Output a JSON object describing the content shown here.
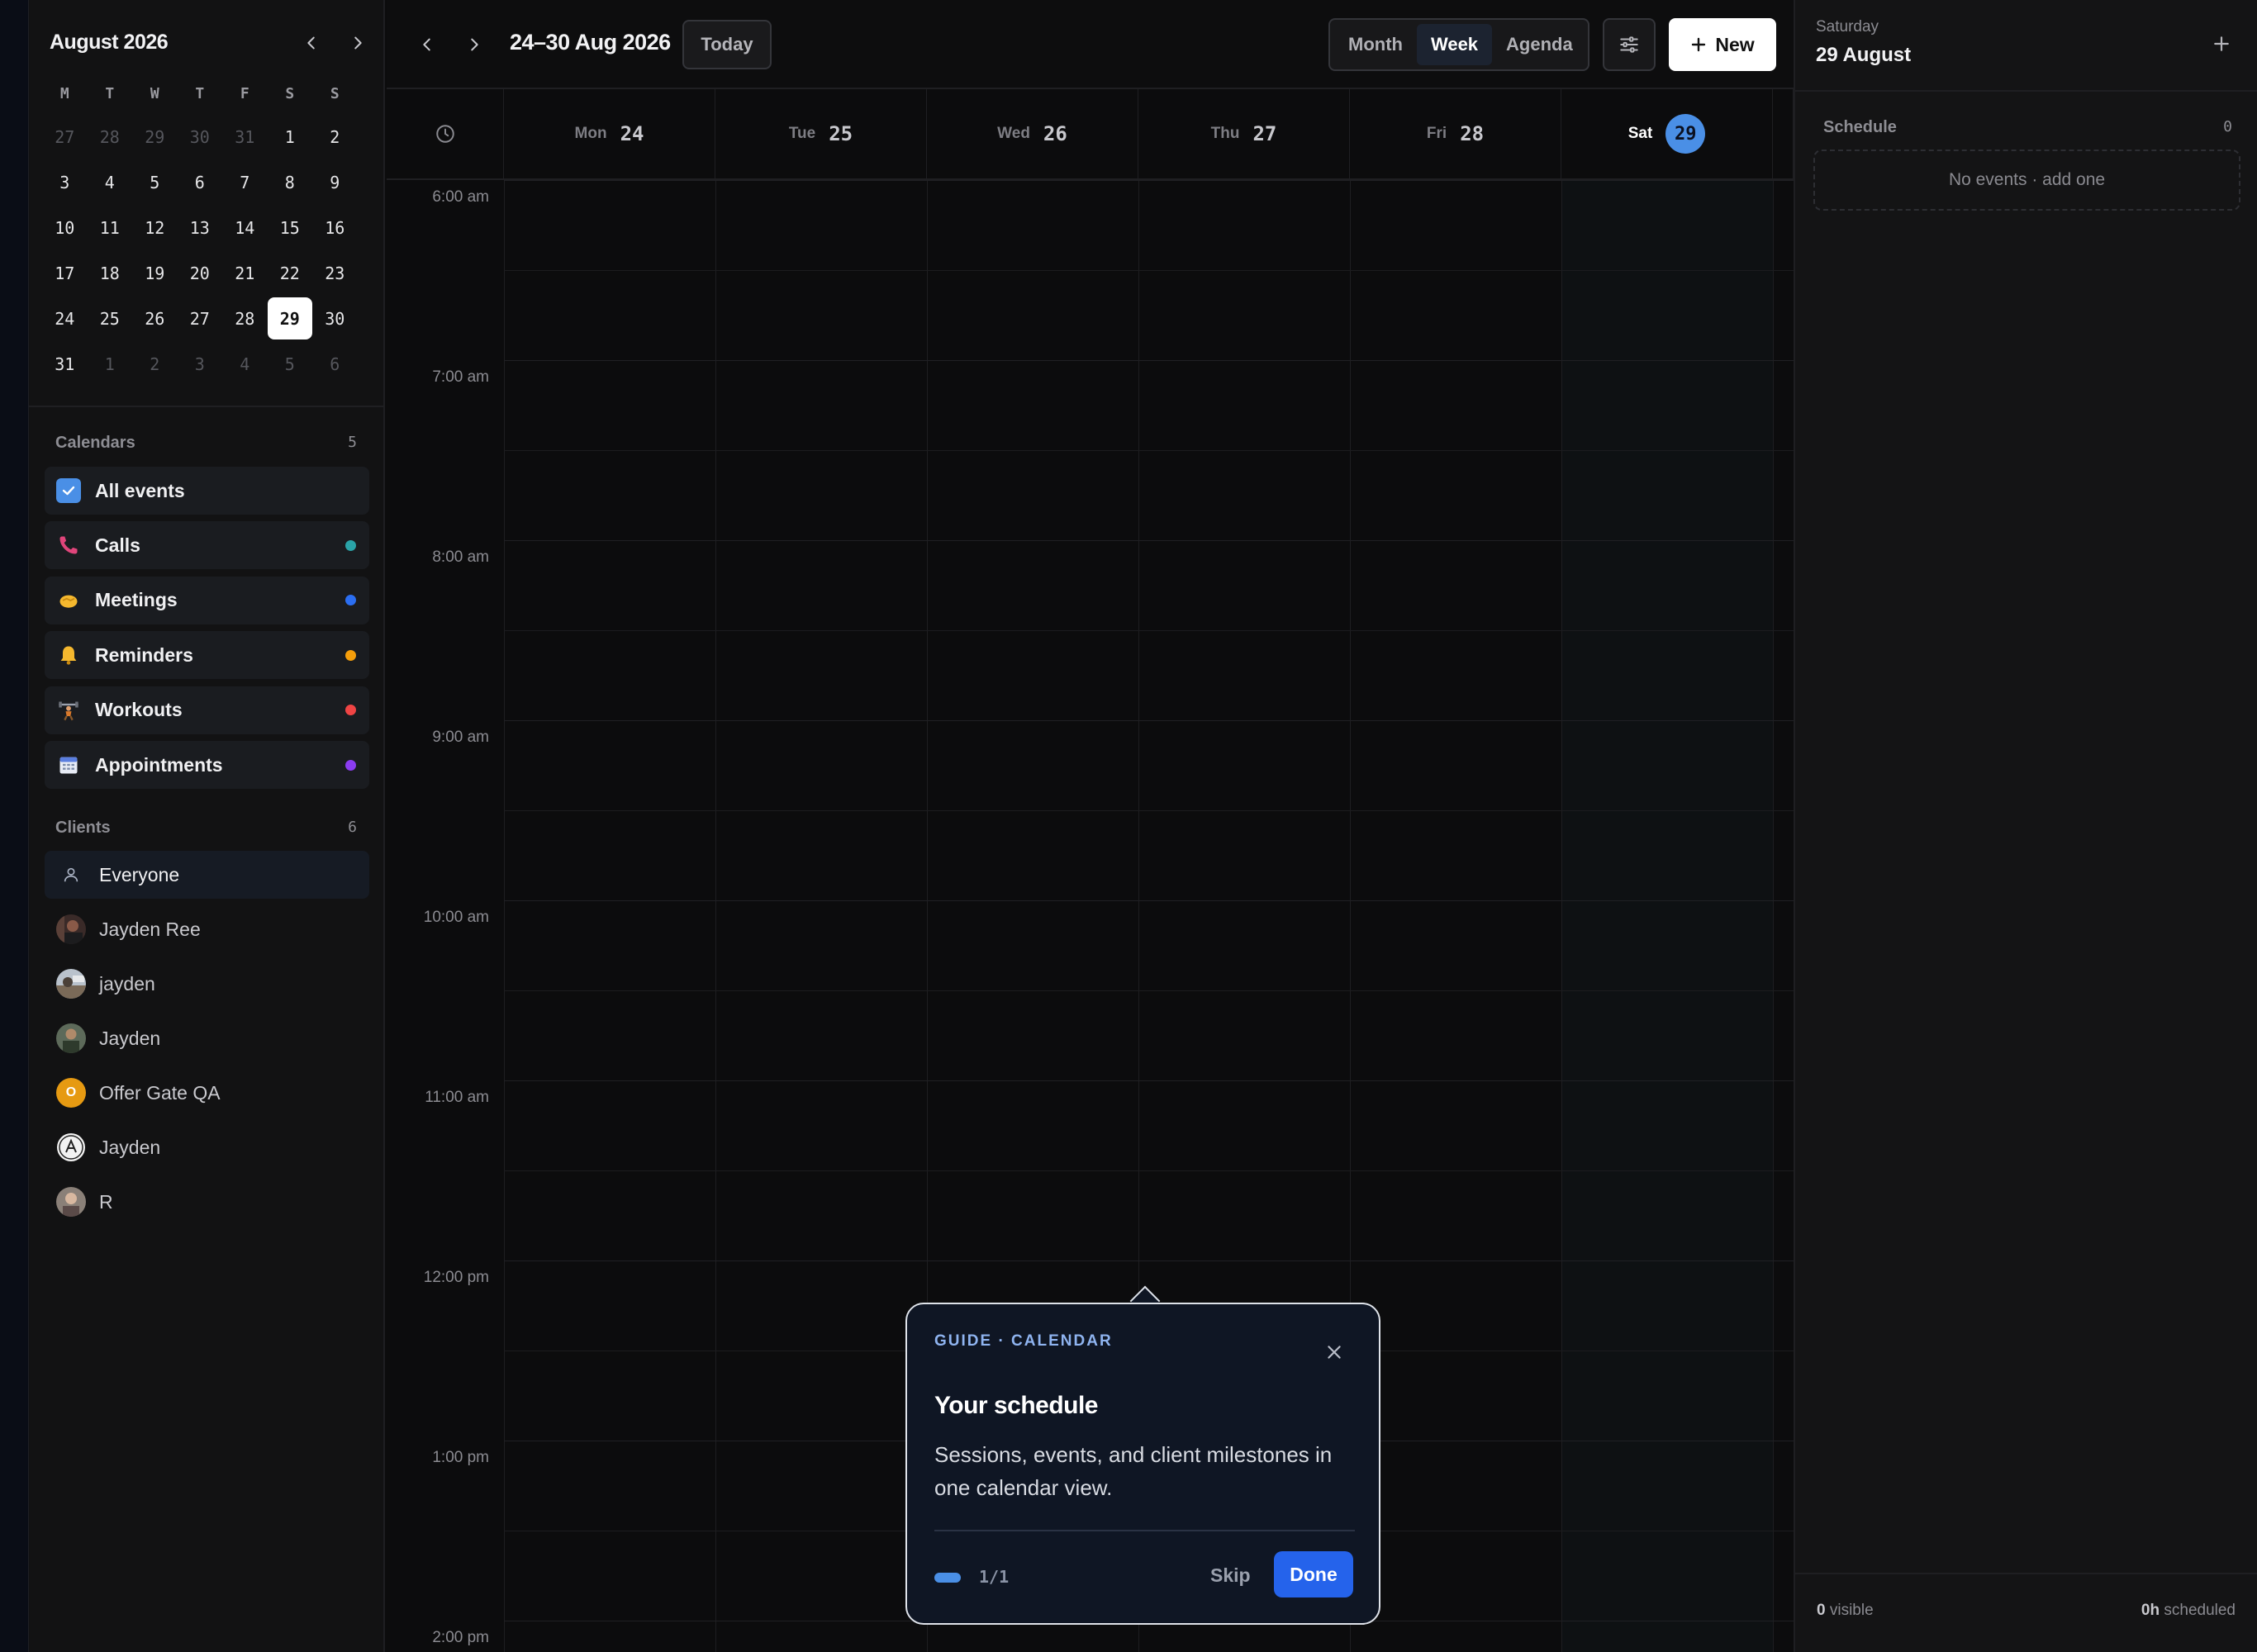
{
  "mini_calendar": {
    "title": "August 2026",
    "weekdays": [
      "M",
      "T",
      "W",
      "T",
      "F",
      "S",
      "S"
    ],
    "weeks": [
      [
        {
          "d": "27",
          "m": true
        },
        {
          "d": "28",
          "m": true
        },
        {
          "d": "29",
          "m": true
        },
        {
          "d": "30",
          "m": true
        },
        {
          "d": "31",
          "m": true
        },
        {
          "d": "1"
        },
        {
          "d": "2"
        }
      ],
      [
        {
          "d": "3"
        },
        {
          "d": "4"
        },
        {
          "d": "5"
        },
        {
          "d": "6"
        },
        {
          "d": "7"
        },
        {
          "d": "8"
        },
        {
          "d": "9"
        }
      ],
      [
        {
          "d": "10"
        },
        {
          "d": "11"
        },
        {
          "d": "12"
        },
        {
          "d": "13"
        },
        {
          "d": "14"
        },
        {
          "d": "15"
        },
        {
          "d": "16"
        }
      ],
      [
        {
          "d": "17"
        },
        {
          "d": "18"
        },
        {
          "d": "19"
        },
        {
          "d": "20"
        },
        {
          "d": "21"
        },
        {
          "d": "22"
        },
        {
          "d": "23"
        }
      ],
      [
        {
          "d": "24"
        },
        {
          "d": "25"
        },
        {
          "d": "26"
        },
        {
          "d": "27"
        },
        {
          "d": "28"
        },
        {
          "d": "29",
          "sel": true
        },
        {
          "d": "30"
        }
      ],
      [
        {
          "d": "31"
        },
        {
          "d": "1",
          "m": true
        },
        {
          "d": "2",
          "m": true
        },
        {
          "d": "3",
          "m": true
        },
        {
          "d": "4",
          "m": true
        },
        {
          "d": "5",
          "m": true
        },
        {
          "d": "6",
          "m": true
        }
      ]
    ]
  },
  "calendars": {
    "heading": "Calendars",
    "count": "5",
    "items": [
      {
        "label": "All events",
        "icon": "checkbox-checked-icon",
        "dot": ""
      },
      {
        "label": "Calls",
        "icon": "phone-icon",
        "dot": "#2aa3a8"
      },
      {
        "label": "Meetings",
        "icon": "handshake-icon",
        "dot": "#2b6ef2"
      },
      {
        "label": "Reminders",
        "icon": "bell-icon",
        "dot": "#f59e0b"
      },
      {
        "label": "Workouts",
        "icon": "weightlifter-icon",
        "dot": "#ef4444"
      },
      {
        "label": "Appointments",
        "icon": "calendar-icon",
        "dot": "#8b3cf0"
      }
    ]
  },
  "clients": {
    "heading": "Clients",
    "count": "6",
    "items": [
      {
        "label": "Everyone",
        "avatar": "person-icon"
      },
      {
        "label": "Jayden Ree",
        "avatar": "photo-avatar"
      },
      {
        "label": "jayden",
        "avatar": "photo-avatar"
      },
      {
        "label": "Jayden",
        "avatar": "photo-avatar"
      },
      {
        "label": "Offer Gate QA",
        "avatar": "initial-avatar",
        "initial": "O"
      },
      {
        "label": "Jayden",
        "avatar": "logo-avatar"
      },
      {
        "label": "R",
        "avatar": "photo-avatar"
      }
    ]
  },
  "toolbar": {
    "range": "24–30 Aug 2026",
    "today_label": "Today",
    "views": [
      "Month",
      "Week",
      "Agenda"
    ],
    "active_view": "Week",
    "new_label": "New"
  },
  "week": {
    "days": [
      {
        "name": "Mon",
        "num": "24"
      },
      {
        "name": "Tue",
        "num": "25"
      },
      {
        "name": "Wed",
        "num": "26"
      },
      {
        "name": "Thu",
        "num": "27"
      },
      {
        "name": "Fri",
        "num": "28"
      },
      {
        "name": "Sat",
        "num": "29",
        "today": true
      }
    ],
    "times": [
      "6:00 am",
      "7:00 am",
      "8:00 am",
      "9:00 am",
      "10:00 am",
      "11:00 am",
      "12:00 pm",
      "1:00 pm",
      "2:00 pm"
    ]
  },
  "right_panel": {
    "weekday": "Saturday",
    "date": "29 August",
    "schedule_label": "Schedule",
    "schedule_count": "0",
    "empty_text": "No events · add one",
    "visible_count": "0",
    "visible_label": "visible",
    "scheduled_count": "0h",
    "scheduled_label": "scheduled"
  },
  "guide": {
    "eyebrow": "GUIDE · CALENDAR",
    "title": "Your schedule",
    "body": "Sessions, events, and client milestones in one calendar view.",
    "step": "1/1",
    "skip_label": "Skip",
    "done_label": "Done"
  },
  "colors": {
    "accent": "#4a8fe6",
    "primary_button": "#2563eb"
  }
}
